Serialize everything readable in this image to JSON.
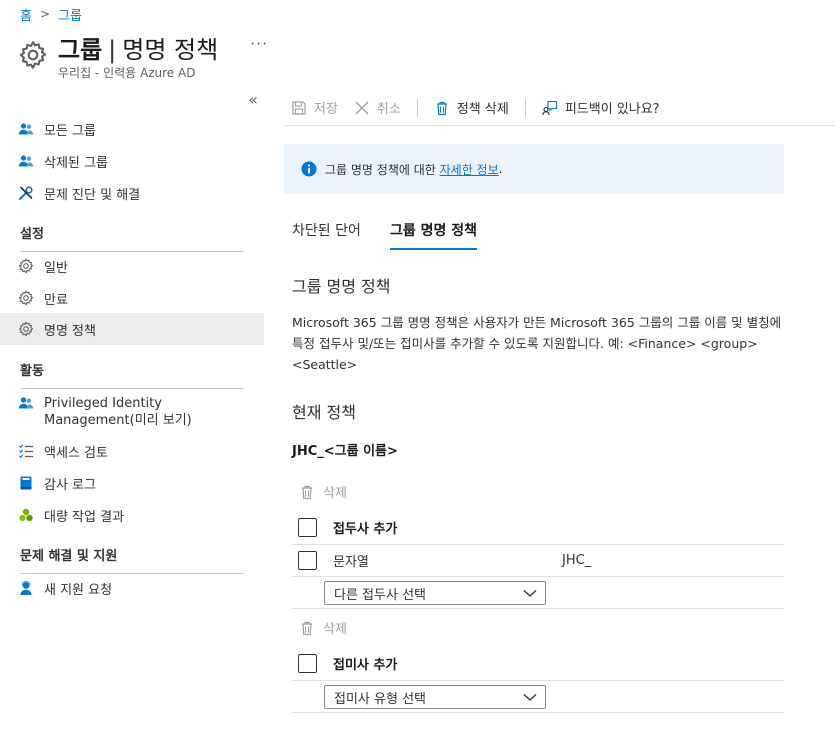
{
  "breadcrumb": {
    "home": "홈",
    "current": "그룹"
  },
  "header": {
    "title_bold": "그룹",
    "title_sep": "|",
    "title_rest": "명명 정책",
    "more": "···",
    "subtitle": "우리집 - 인력용 Azure AD"
  },
  "sidebar": {
    "collapse": "«",
    "items_top": [
      {
        "label": "모든 그룹",
        "icon": "users-icon"
      },
      {
        "label": "삭제된 그룹",
        "icon": "users-icon"
      },
      {
        "label": "문제 진단 및 해결",
        "icon": "wrench-icon"
      }
    ],
    "section_settings": "설정",
    "items_settings": [
      {
        "label": "일반",
        "icon": "gear-icon"
      },
      {
        "label": "만료",
        "icon": "gear-icon"
      },
      {
        "label": "명명 정책",
        "icon": "gear-icon",
        "selected": true
      }
    ],
    "section_activity": "활동",
    "items_activity": [
      {
        "label": "Privileged Identity Management(미리 보기)",
        "icon": "users-icon"
      },
      {
        "label": "액세스 검토",
        "icon": "checklist-icon"
      },
      {
        "label": "감사 로그",
        "icon": "book-icon"
      },
      {
        "label": "대량 작업 결과",
        "icon": "bulk-icon"
      }
    ],
    "section_support": "문제 해결 및 지원",
    "items_support": [
      {
        "label": "새 지원 요청",
        "icon": "person-support-icon"
      }
    ]
  },
  "toolbar": {
    "save": "저장",
    "cancel": "취소",
    "delete_policy": "정책 삭제",
    "feedback": "피드백이 있나요?"
  },
  "info": {
    "text_before": "그룹 명명 정책에 대한 ",
    "link": "자세한 정보",
    "text_after": "."
  },
  "tabs": [
    {
      "label": "차단된 단어",
      "active": false
    },
    {
      "label": "그룹 명명 정책",
      "active": true
    }
  ],
  "main": {
    "section_title": "그룹 명명 정책",
    "description": "Microsoft 365 그룹 명명 정책은 사용자가 만든 Microsoft 365 그룹의 그룹 이름 및 별칭에 특정 접두사 및/또는 접미사를 추가할 수 있도록 지원합니다. 예: <Finance> <group> <Seattle>",
    "current_policy_title": "현재 정책",
    "current_policy_value": "JHC_<그룹 이름>",
    "prefix_delete": "삭제",
    "prefix_header": "접두사 추가",
    "prefix_row_label": "문자열",
    "prefix_row_value": "JHC_",
    "prefix_select": "다른 접두사 선택",
    "suffix_delete": "삭제",
    "suffix_header": "접미사 추가",
    "suffix_select": "접미사 유형 선택"
  },
  "colors": {
    "accent": "#0078d4",
    "info_bg": "#eaf3fc",
    "selected_nav": "#ececec",
    "disabled": "#a19f9d"
  }
}
